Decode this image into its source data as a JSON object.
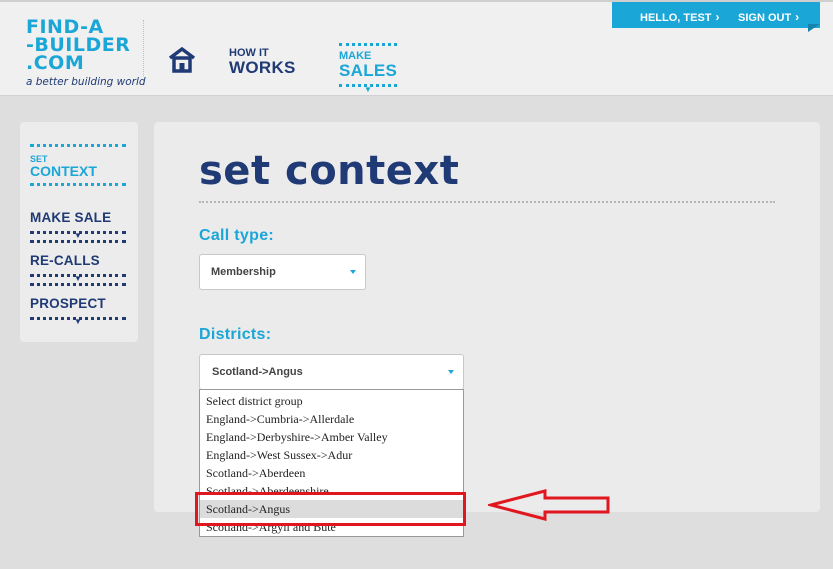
{
  "header": {
    "logo": {
      "line1": "FIND-A",
      "line2": "-BUILDER",
      "line3": ".COM",
      "tagline": "a better building world"
    },
    "nav": [
      {
        "small": "HOW IT",
        "big": "WORKS"
      },
      {
        "small": "MAKE",
        "big": "SALES"
      }
    ],
    "user": {
      "greeting": "HELLO, TEST",
      "signout": "SIGN OUT"
    }
  },
  "sidebar": {
    "items": [
      {
        "small": "SET",
        "big": "CONTEXT"
      },
      {
        "label": "MAKE SALE"
      },
      {
        "label": "RE-CALLS"
      },
      {
        "label": "PROSPECT"
      }
    ]
  },
  "main": {
    "title": "set context",
    "call_type": {
      "label": "Call type:",
      "value": "Membership"
    },
    "districts": {
      "label": "Districts:",
      "value": "Scotland->Angus",
      "options": [
        "Select district group",
        "England->Cumbria->Allerdale",
        "England->Derbyshire->Amber Valley",
        "England->West Sussex->Adur",
        "Scotland->Aberdeen",
        "Scotland->Aberdeenshire",
        "Scotland->Angus",
        "Scotland->Argyll and Bute"
      ]
    }
  },
  "colors": {
    "brand_blue": "#1ba6d8",
    "navy": "#1f3a75",
    "annotation_red": "#e0171f"
  }
}
